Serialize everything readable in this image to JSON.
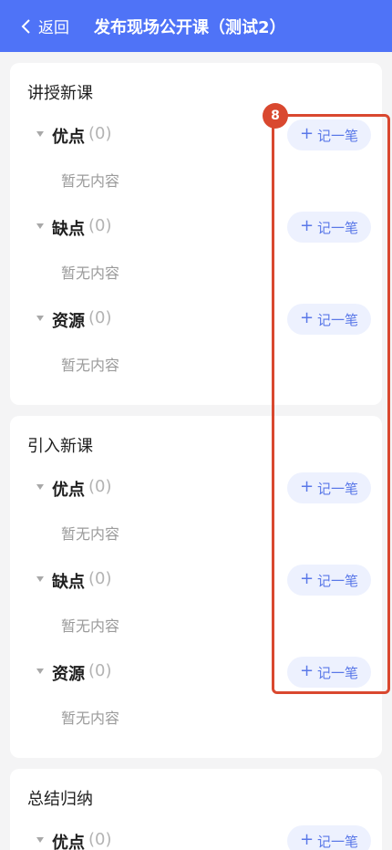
{
  "header": {
    "back_label": "返回",
    "title": "发布现场公开课（测试2）",
    "background": "#4f73f7"
  },
  "empty_text": "暂无内容",
  "note_button_label": "记一笔",
  "sections": [
    {
      "title": "讲授新课",
      "items": [
        {
          "label": "优点",
          "count": "(0)"
        },
        {
          "label": "缺点",
          "count": "(0)"
        },
        {
          "label": "资源",
          "count": "(0)"
        }
      ]
    },
    {
      "title": "引入新课",
      "items": [
        {
          "label": "优点",
          "count": "(0)"
        },
        {
          "label": "缺点",
          "count": "(0)"
        },
        {
          "label": "资源",
          "count": "(0)"
        }
      ]
    },
    {
      "title": "总结归纳",
      "items": [
        {
          "label": "优点",
          "count": "(0)"
        }
      ]
    }
  ],
  "annotation": {
    "badge": "8",
    "color": "#d9482f"
  }
}
